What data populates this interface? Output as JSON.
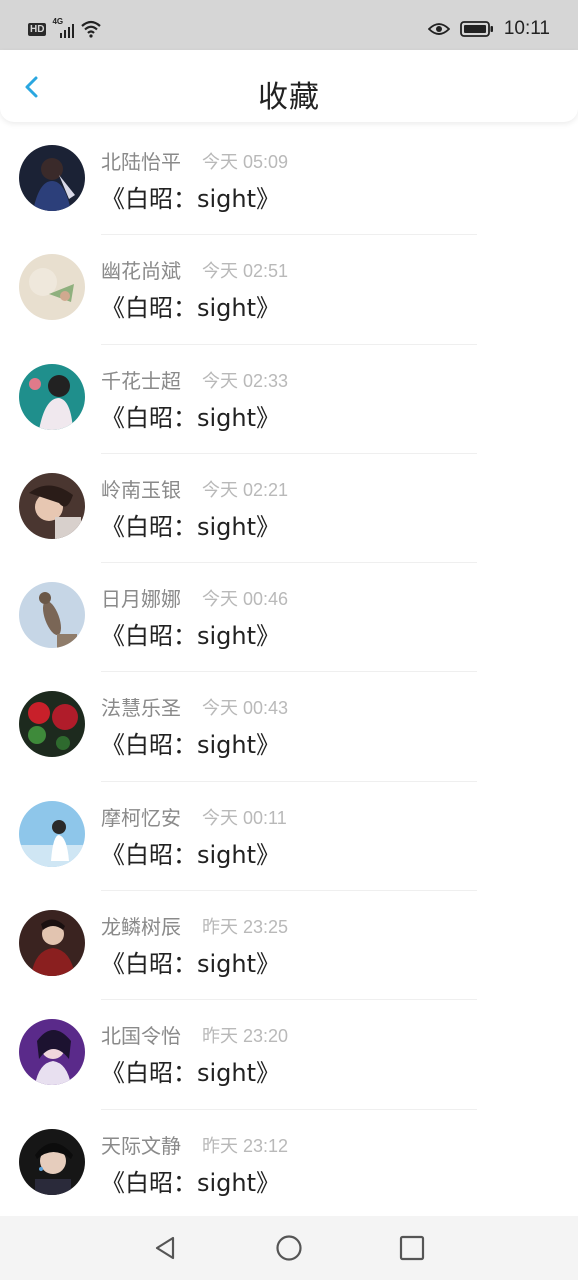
{
  "status_bar": {
    "network_badge": "HD",
    "network_type": "4G",
    "time": "10:11",
    "icons": [
      "hd-icon",
      "signal-icon",
      "wifi-icon",
      "eye-icon",
      "battery-icon"
    ]
  },
  "header": {
    "title": "收藏",
    "back_icon": "chevron-left-icon",
    "accent_color": "#2aa7e0"
  },
  "favorites": [
    {
      "name": "北陆怡平",
      "time": "今天 05:09",
      "content": "《白昭：sight》"
    },
    {
      "name": "幽花尚斌",
      "time": "今天 02:51",
      "content": "《白昭：sight》"
    },
    {
      "name": "千花士超",
      "time": "今天 02:33",
      "content": "《白昭：sight》"
    },
    {
      "name": "岭南玉银",
      "time": "今天 02:21",
      "content": "《白昭：sight》"
    },
    {
      "name": "日月娜娜",
      "time": "今天 00:46",
      "content": "《白昭：sight》"
    },
    {
      "name": "法慧乐圣",
      "time": "今天 00:43",
      "content": "《白昭：sight》"
    },
    {
      "name": "摩柯忆安",
      "time": "今天 00:11",
      "content": "《白昭：sight》"
    },
    {
      "name": "龙鳞树辰",
      "time": "昨天 23:25",
      "content": "《白昭：sight》"
    },
    {
      "name": "北国令怡",
      "time": "昨天 23:20",
      "content": "《白昭：sight》"
    },
    {
      "name": "天际文静",
      "time": "昨天 23:12",
      "content": "《白昭：sight》"
    }
  ],
  "nav_bar": {
    "icons": [
      "back-triangle-icon",
      "home-circle-icon",
      "recents-square-icon"
    ]
  }
}
